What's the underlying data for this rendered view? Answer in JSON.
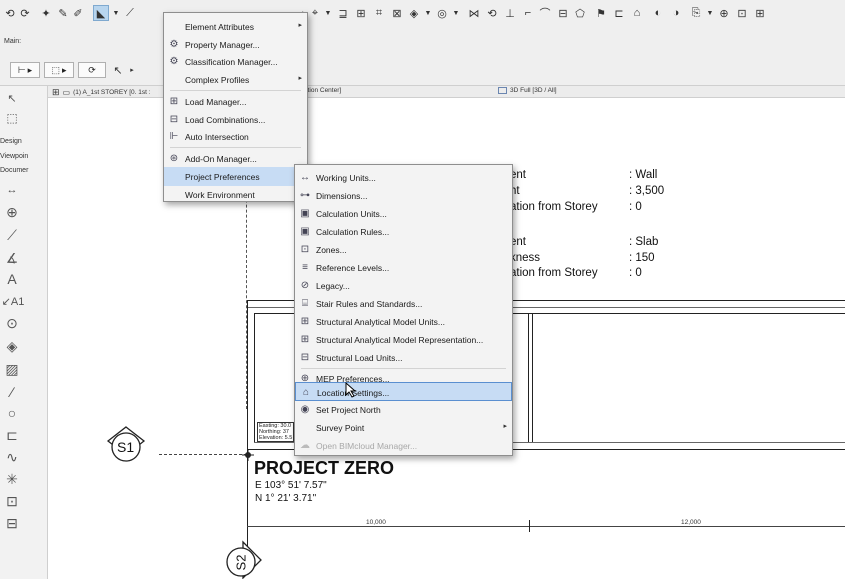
{
  "window": {
    "main_label": "Main:",
    "tabs": [
      {
        "label": "(1) A_1st STOREY [0. 1st :"
      },
      {
        "label": "Action Center]"
      },
      {
        "label": "3D Full [3D / All]"
      }
    ]
  },
  "left_toolbox": {
    "labels": [
      "Design",
      "Viewpoin",
      "Documer"
    ],
    "icons": [
      "arrow-icon",
      "marquee-icon",
      "dimension-icon",
      "level-dimension-icon",
      "radial-dimension-icon",
      "angle-dimension-icon",
      "text-icon",
      "label-icon",
      "section-marker-icon",
      "fill-icon",
      "hatch-icon",
      "line-icon",
      "circle-icon",
      "polyline-icon",
      "spline-icon",
      "hotspot-icon",
      "figure-icon",
      "drawing-icon"
    ]
  },
  "main_menu": {
    "items": [
      {
        "label": "Element Attributes",
        "icon": "attributes-icon",
        "submenu": true
      },
      {
        "label": "Property Manager...",
        "icon": "property-icon",
        "submenu": false
      },
      {
        "label": "Classification Manager...",
        "icon": "classification-icon",
        "submenu": false
      },
      {
        "label": "Complex Profiles",
        "icon": "",
        "submenu": true
      },
      {
        "label": "Load Manager...",
        "icon": "load-icon",
        "submenu": false
      },
      {
        "label": "Load Combinations...",
        "icon": "load-combination-icon",
        "submenu": false
      },
      {
        "label": "Auto Intersection",
        "icon": "intersection-icon",
        "submenu": false
      },
      {
        "label": "Add-On Manager...",
        "icon": "addon-icon",
        "submenu": false
      },
      {
        "label": "Project Preferences",
        "icon": "",
        "submenu": true
      },
      {
        "label": "Work Environment",
        "icon": "",
        "submenu": true
      }
    ]
  },
  "submenu": {
    "items": [
      {
        "label": "Working Units...",
        "icon": "units-icon",
        "submenu": false
      },
      {
        "label": "Dimensions...",
        "icon": "dimensions-icon",
        "submenu": false
      },
      {
        "label": "Calculation Units...",
        "icon": "calc-units-icon",
        "submenu": false
      },
      {
        "label": "Calculation Rules...",
        "icon": "calc-rules-icon",
        "submenu": false
      },
      {
        "label": "Zones...",
        "icon": "zones-icon",
        "submenu": false
      },
      {
        "label": "Reference Levels...",
        "icon": "levels-icon",
        "submenu": false
      },
      {
        "label": "Legacy...",
        "icon": "legacy-icon",
        "submenu": false
      },
      {
        "label": "Stair Rules and Standards...",
        "icon": "stair-icon",
        "submenu": false
      },
      {
        "label": "Structural Analytical Model Units...",
        "icon": "sam-units-icon",
        "submenu": false
      },
      {
        "label": "Structural Analytical Model Representation...",
        "icon": "sam-repr-icon",
        "submenu": false
      },
      {
        "label": "Structural Load Units...",
        "icon": "load-units-icon",
        "submenu": false
      },
      {
        "label": "MEP Preferences...",
        "icon": "mep-icon",
        "submenu": false
      },
      {
        "label": "Location Settings...",
        "icon": "location-icon",
        "submenu": false
      },
      {
        "label": "Set Project North",
        "icon": "north-icon",
        "submenu": false
      },
      {
        "label": "Survey Point",
        "icon": "",
        "submenu": true
      },
      {
        "label": "Open BIMcloud Manager...",
        "icon": "bimcloud-icon",
        "submenu": false
      }
    ]
  },
  "element_info": {
    "wall": {
      "rows": [
        [
          "ent",
          ": Wall"
        ],
        [
          "ht",
          ": 3,500"
        ],
        [
          "ation from Storey",
          ": 0"
        ]
      ]
    },
    "slab": {
      "rows": [
        [
          "ent",
          ": Slab"
        ],
        [
          "kness",
          ": 150"
        ],
        [
          "ation from Storey",
          ": 0"
        ]
      ]
    }
  },
  "drawing": {
    "section_markers": [
      "S1",
      "S2"
    ],
    "coord_box": [
      "Easting: 30.0",
      "Northing: 37",
      "Elevation: 5.5"
    ],
    "project_title": "PROJECT ZERO",
    "easting": "E 103° 51' 7.57\"",
    "northing": "N 1° 21' 3.71\"",
    "dimensions": [
      "10,000",
      "12,000"
    ]
  },
  "colors": {
    "menu_highlight": "#c7dcf4",
    "menu_hover_border": "#5a8fd0",
    "toolbar_bg": "#efefef"
  }
}
